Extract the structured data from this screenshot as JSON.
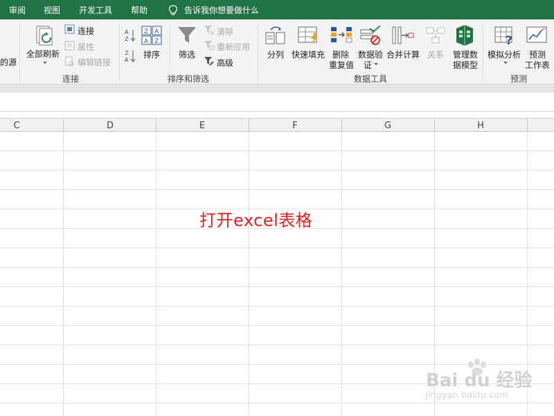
{
  "tabs": {
    "review": "审阅",
    "view": "视图",
    "developer": "开发工具",
    "help": "帮助",
    "tell_me": "告诉我你想要做什么"
  },
  "ribbon": {
    "source_partial": "的源",
    "connections": {
      "refresh_all": "全部刷新",
      "connections": "连接",
      "properties": "属性",
      "edit_links": "编辑链接",
      "group": "连接"
    },
    "sort_filter": {
      "sort": "排序",
      "filter": "筛选",
      "clear": "清除",
      "reapply": "重新应用",
      "advanced": "高级",
      "group": "排序和筛选"
    },
    "data_tools": {
      "text_to_columns": "分列",
      "flash_fill": "快速填充",
      "remove_duplicates_1": "删除",
      "remove_duplicates_2": "重复值",
      "data_validation_1": "数据验",
      "data_validation_2": "证",
      "consolidate": "合并计算",
      "relationships": "关系",
      "manage_model_1": "管理数",
      "manage_model_2": "据模型",
      "group": "数据工具"
    },
    "forecast": {
      "what_if": "模拟分析",
      "forecast_sheet_1": "预测",
      "forecast_sheet_2": "工作表",
      "group": "预测"
    }
  },
  "columns": [
    "C",
    "D",
    "E",
    "F",
    "G",
    "H"
  ],
  "annotation": "打开excel表格",
  "watermark": {
    "brand": "Bai du 经验",
    "url": "jingyan.baidu.com"
  },
  "colors": {
    "ribbon_green": "#217346",
    "annotation_red": "#e8201c"
  }
}
